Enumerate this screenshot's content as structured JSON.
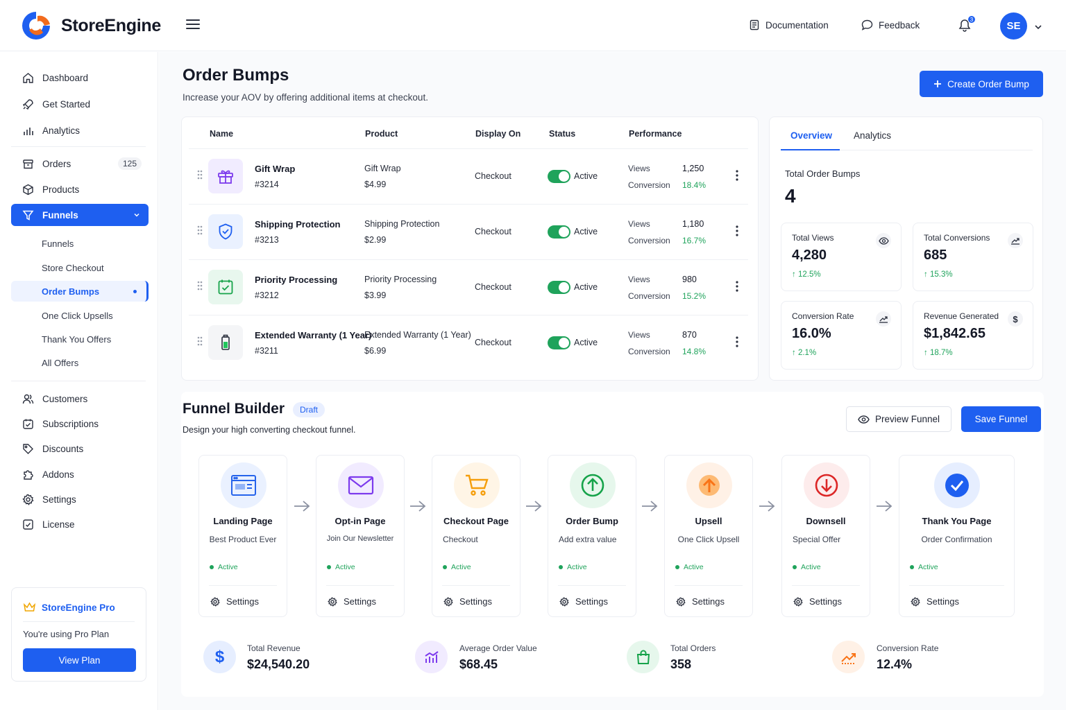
{
  "header": {
    "brand": "StoreEngine",
    "documentation": "Documentation",
    "feedback": "Feedback",
    "notification_count": "3",
    "avatar_initials": "SE"
  },
  "sidebar": {
    "items": [
      {
        "label": "Dashboard",
        "icon": "home-icon"
      },
      {
        "label": "Get Started",
        "icon": "rocket-icon"
      },
      {
        "label": "Analytics",
        "icon": "bar-chart-icon"
      },
      {
        "label": "Orders",
        "icon": "box-icon",
        "count": "125"
      },
      {
        "label": "Products",
        "icon": "package-icon"
      },
      {
        "label": "Funnels",
        "icon": "filter-icon",
        "active": true
      },
      {
        "label": "Customers",
        "icon": "users-icon"
      },
      {
        "label": "Subscriptions",
        "icon": "calendar-check-icon"
      },
      {
        "label": "Discounts",
        "icon": "tag-icon"
      },
      {
        "label": "Addons",
        "icon": "puzzle-icon"
      },
      {
        "label": "Settings",
        "icon": "gear-icon"
      },
      {
        "label": "License",
        "icon": "license-icon"
      }
    ],
    "funnel_sub": [
      "Funnels",
      "Store Checkout",
      "Order Bumps",
      "One Click Upsells",
      "Thank You Offers",
      "All Offers"
    ],
    "pro": {
      "title": "StoreEngine Pro",
      "text": "You're using Pro Plan",
      "button": "View Plan"
    }
  },
  "page": {
    "title": "Order Bumps",
    "subtitle": "Increase your AOV by offering additional items at checkout.",
    "create_button": "Create Order Bump"
  },
  "table": {
    "columns": [
      "Name",
      "Product",
      "Display On",
      "Status",
      "Performance"
    ],
    "rows": [
      {
        "name": "Gift Wrap",
        "id": "#3214",
        "product": "Gift Wrap",
        "price": "$4.99",
        "display": "Checkout",
        "status": "Active",
        "views_label": "Views",
        "views": "1,250",
        "conv_label": "Conversion",
        "conversion": "18.4%",
        "icon": "gift-icon"
      },
      {
        "name": "Shipping Protection",
        "id": "#3213",
        "product": "Shipping Protection",
        "price": "$2.99",
        "display": "Checkout",
        "status": "Active",
        "views_label": "Views",
        "views": "1,180",
        "conv_label": "Conversion",
        "conversion": "16.7%",
        "icon": "shield-icon"
      },
      {
        "name": "Priority Processing",
        "id": "#3212",
        "product": "Priority Processing",
        "price": "$3.99",
        "display": "Checkout",
        "status": "Active",
        "views_label": "Views",
        "views": "980",
        "conv_label": "Conversion",
        "conversion": "15.2%",
        "icon": "calendar-check-icon"
      },
      {
        "name": "Extended Warranty (1 Year)",
        "id": "#3211",
        "product": "Extended Warranty (1 Year)",
        "price": "$6.99",
        "display": "Checkout",
        "status": "Active",
        "views_label": "Views",
        "views": "870",
        "conv_label": "Conversion",
        "conversion": "14.8%",
        "icon": "battery-icon"
      }
    ]
  },
  "overview": {
    "tabs": [
      "Overview",
      "Analytics"
    ],
    "total_label": "Total Order Bumps",
    "total_value": "4",
    "stats": [
      {
        "label": "Total Views",
        "value": "4,280",
        "change": "12.5%",
        "icon": "eye-icon"
      },
      {
        "label": "Total Conversions",
        "value": "685",
        "change": "15.3%",
        "icon": "trend-up-icon"
      },
      {
        "label": "Conversion Rate",
        "value": "16.0%",
        "change": "2.1%",
        "icon": "trend-up-icon"
      },
      {
        "label": "Revenue Generated",
        "value": "$1,842.65",
        "change": "18.7%",
        "icon": "dollar-icon"
      }
    ]
  },
  "funnel": {
    "title": "Funnel Builder",
    "badge": "Draft",
    "subtitle": "Design your high converting checkout funnel.",
    "preview_button": "Preview Funnel",
    "save_button": "Save Funnel",
    "steps": [
      {
        "title": "Landing Page",
        "sub": "Best Product Ever",
        "status": "Active",
        "settings": "Settings",
        "color": "#2563eb"
      },
      {
        "title": "Opt-in Page",
        "sub": "Join Our Newsletter",
        "status": "Active",
        "settings": "Settings",
        "color": "#7c3aed"
      },
      {
        "title": "Checkout Page",
        "sub": "Checkout",
        "status": "Active",
        "settings": "Settings",
        "color": "#f59e0b"
      },
      {
        "title": "Order Bump",
        "sub": "Add extra value",
        "status": "Active",
        "settings": "Settings",
        "color": "#16a34a"
      },
      {
        "title": "Upsell",
        "sub": "One Click Upsell",
        "status": "Active",
        "settings": "Settings",
        "color": "#f97316"
      },
      {
        "title": "Downsell",
        "sub": "Special Offer",
        "status": "Active",
        "settings": "Settings",
        "color": "#dc2626"
      },
      {
        "title": "Thank You Page",
        "sub": "Order Confirmation",
        "status": "Active",
        "settings": "Settings",
        "color": "#1e5ff0"
      }
    ],
    "metrics": [
      {
        "label": "Total Revenue",
        "value": "$24,540.20",
        "icon": "dollar-icon"
      },
      {
        "label": "Average Order Value",
        "value": "$68.45",
        "icon": "bar-chart-icon"
      },
      {
        "label": "Total Orders",
        "value": "358",
        "icon": "shopping-bag-icon"
      },
      {
        "label": "Conversion Rate",
        "value": "12.4%",
        "icon": "trend-up-icon"
      }
    ]
  }
}
